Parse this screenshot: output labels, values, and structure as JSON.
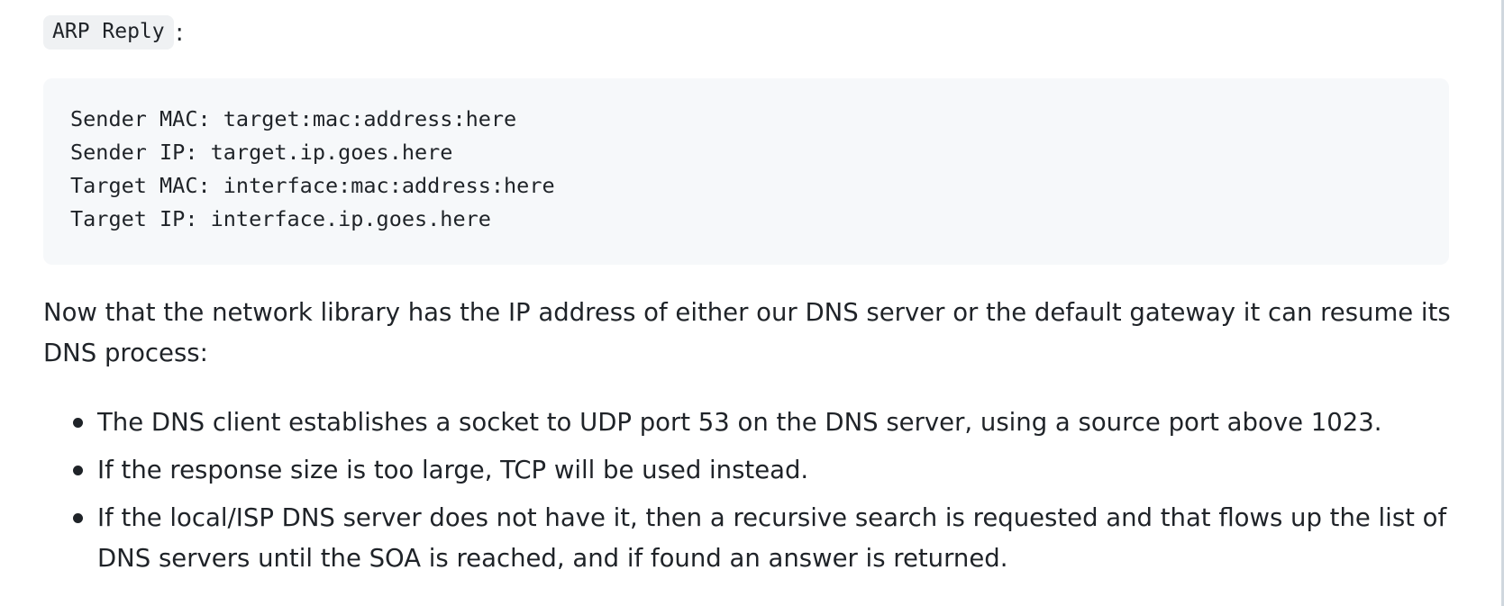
{
  "heading": {
    "code": "ARP Reply",
    "suffix": ":"
  },
  "code_block": {
    "lines": [
      "Sender MAC: target:mac:address:here",
      "Sender IP: target.ip.goes.here",
      "Target MAC: interface:mac:address:here",
      "Target IP: interface.ip.goes.here"
    ]
  },
  "paragraph": "Now that the network library has the IP address of either our DNS server or the default gateway it can resume its DNS process:",
  "bullets": [
    "The DNS client establishes a socket to UDP port 53 on the DNS server, using a source port above 1023.",
    "If the response size is too large, TCP will be used instead.",
    "If the local/ISP DNS server does not have it, then a recursive search is requested and that flows up the list of DNS servers until the SOA is reached, and if found an answer is returned."
  ]
}
